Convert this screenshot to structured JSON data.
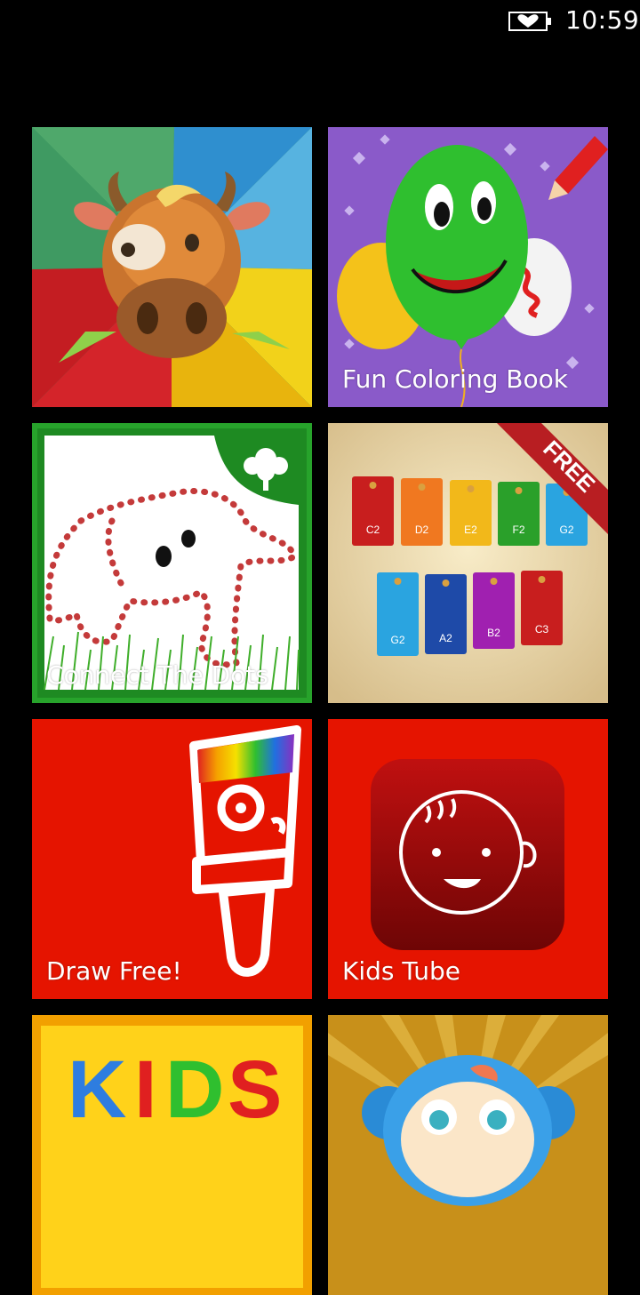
{
  "status_bar": {
    "time": "10:59",
    "battery_icon": "battery-heart-icon"
  },
  "tiles": [
    {
      "label": "",
      "icon": "cow-face-icon"
    },
    {
      "label": "Fun Coloring Book",
      "icon": "balloon-face-icon"
    },
    {
      "label": "Connect The Dots",
      "icon": "elephant-dots-icon"
    },
    {
      "label": "",
      "icon": "xylophone-icon",
      "ribbon": "FREE",
      "keys": [
        "C2",
        "D2",
        "E2",
        "F2",
        "G2",
        "G2",
        "A2",
        "B2",
        "C3"
      ]
    },
    {
      "label": "Draw Free!",
      "icon": "paintbrush-icon"
    },
    {
      "label": "Kids Tube",
      "icon": "baby-face-icon"
    },
    {
      "label": "",
      "icon": "kids-letters-icon",
      "text": "KIDS"
    },
    {
      "label": "",
      "icon": "monkey-face-icon"
    }
  ],
  "colors": {
    "accent_red": "#e51400",
    "background": "#000000"
  }
}
